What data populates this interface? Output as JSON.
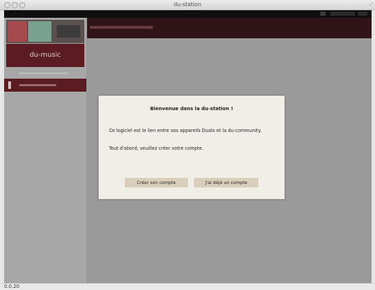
{
  "window": {
    "title": "du-station"
  },
  "sidebar": {
    "brand": "du-music"
  },
  "dialog": {
    "title": "Bienvenue dans la du-station !",
    "paragraph1": "Ce logiciel est le lien entre vos appareils Dualo et la du-community.",
    "paragraph2": "Tout d'abord, veuillez créer votre compte.",
    "create_account_label": "Créer son compte",
    "have_account_label": "J'ai déjà un compte"
  },
  "statusbar": {
    "version": "0.0.20"
  },
  "colors": {
    "accent_dark": "#301418",
    "accent": "#5a1c22",
    "dialog_bg": "#f1eee8",
    "button_bg": "#d9cdbc"
  }
}
